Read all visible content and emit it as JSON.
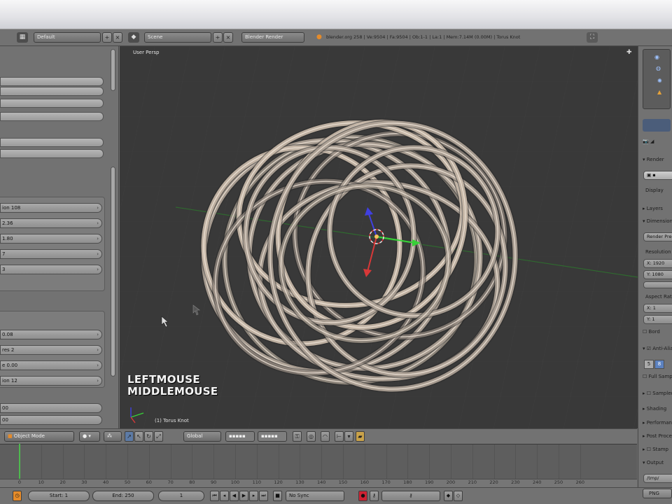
{
  "info_header": {
    "screen_layout": "Default",
    "scene": "Scene",
    "render_engine": "Blender Render",
    "stats": "blender.org 258 | Ve:9504 | Fa:9504 | Ob:1-1 | La:1 | Mem:7.14M (0.00M) | Torus Knot"
  },
  "left_panel": {
    "num_fields": [
      {
        "label": "ion 108"
      },
      {
        "label": "2.36"
      },
      {
        "label": "1.80"
      },
      {
        "label": "7"
      },
      {
        "label": "3"
      }
    ],
    "num_fields_2": [
      {
        "label": "0.08"
      },
      {
        "label": "res 2"
      },
      {
        "label": "e 0.00"
      },
      {
        "label": "ion 12"
      }
    ],
    "bottom_fields": [
      {
        "label": "00"
      },
      {
        "label": "00"
      }
    ]
  },
  "viewport": {
    "view_label": "User Persp",
    "key_primary": "LEFTMOUSE",
    "key_secondary": "MIDDLEMOUSE",
    "object_name": "(1) Torus Knot"
  },
  "viewport_header": {
    "mode": "Object Mode",
    "orientation": "Global"
  },
  "timeline": {
    "ticks": [
      "0",
      "10",
      "20",
      "30",
      "40",
      "50",
      "60",
      "70",
      "80",
      "90",
      "100",
      "110",
      "120",
      "130",
      "140",
      "150",
      "160",
      "170",
      "180",
      "190",
      "200",
      "210",
      "220",
      "230",
      "240",
      "250",
      "260"
    ],
    "start": "Start: 1",
    "end": "End: 250",
    "current": "1",
    "sync": "No Sync"
  },
  "right_panel": {
    "render_label": "Render",
    "display_label": "Display",
    "layers_label": "Layers",
    "dimensions_label": "Dimensions",
    "preset": "Render Presets",
    "resolution_label": "Resolution",
    "x_res": "X: 1920",
    "y_res": "Y: 1080",
    "aspect_label": "Aspect Ratio",
    "x_asp": "X: 1",
    "y_asp": "Y: 1",
    "border_label": "Bord",
    "antialias_label": "Anti-Aliasing",
    "aa_5": "5",
    "aa_8": "8",
    "full_sample": "Full Sample",
    "sampled": "Sampled Motion Blur",
    "shading": "Shading",
    "performance": "Performance",
    "post_processing": "Post Processing",
    "stamp": "Stamp",
    "output": "Output",
    "output_path": "/tmp/",
    "format": "PNG"
  },
  "colors": {
    "viewport_bg": "#393939",
    "torus": "#c8b8a8",
    "axis_x": "#d83838",
    "axis_y": "#38d038",
    "axis_z": "#4040e0",
    "timeline_cursor": "#4fb94f"
  }
}
